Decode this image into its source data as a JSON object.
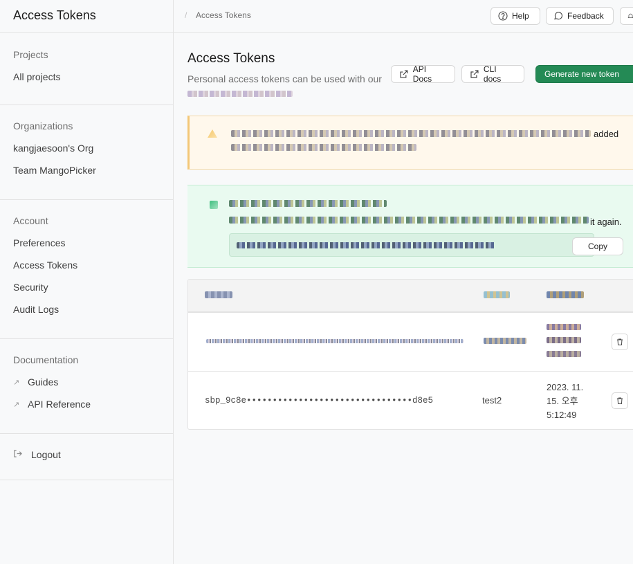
{
  "sidebar": {
    "title": "Access Tokens",
    "sections": [
      {
        "heading": "Projects",
        "items": [
          "All projects"
        ]
      },
      {
        "heading": "Organizations",
        "items": [
          "kangjaesoon's Org",
          "Team MangoPicker"
        ]
      },
      {
        "heading": "Account",
        "items": [
          "Preferences",
          "Access Tokens",
          "Security",
          "Audit Logs"
        ]
      },
      {
        "heading": "Documentation",
        "items": [
          "Guides",
          "API Reference"
        ]
      }
    ],
    "logout": "Logout"
  },
  "topbar": {
    "breadcrumb_sep": "/",
    "breadcrumb": "Access Tokens",
    "help": "Help",
    "feedback": "Feedback"
  },
  "main": {
    "title": "Access Tokens",
    "subtitle": "Personal access tokens can be used with our",
    "api_docs": "API Docs",
    "cli_docs": "CLI docs",
    "generate": "Generate new token",
    "warning_tail": "added",
    "success_tail": "it again.",
    "copy": "Copy"
  },
  "table": {
    "rows": [
      {
        "token": "",
        "name": "",
        "created": ""
      },
      {
        "token": "sbp_9c8e••••••••••••••••••••••••••••••••d8e5",
        "name": "test2",
        "created_lines": [
          "2023. 11.",
          "15. 오후",
          "5:12:49"
        ]
      }
    ]
  },
  "colors": {
    "primary": "#248a55",
    "warning_bg": "#fff8ec",
    "success_bg": "#e9faf0"
  }
}
